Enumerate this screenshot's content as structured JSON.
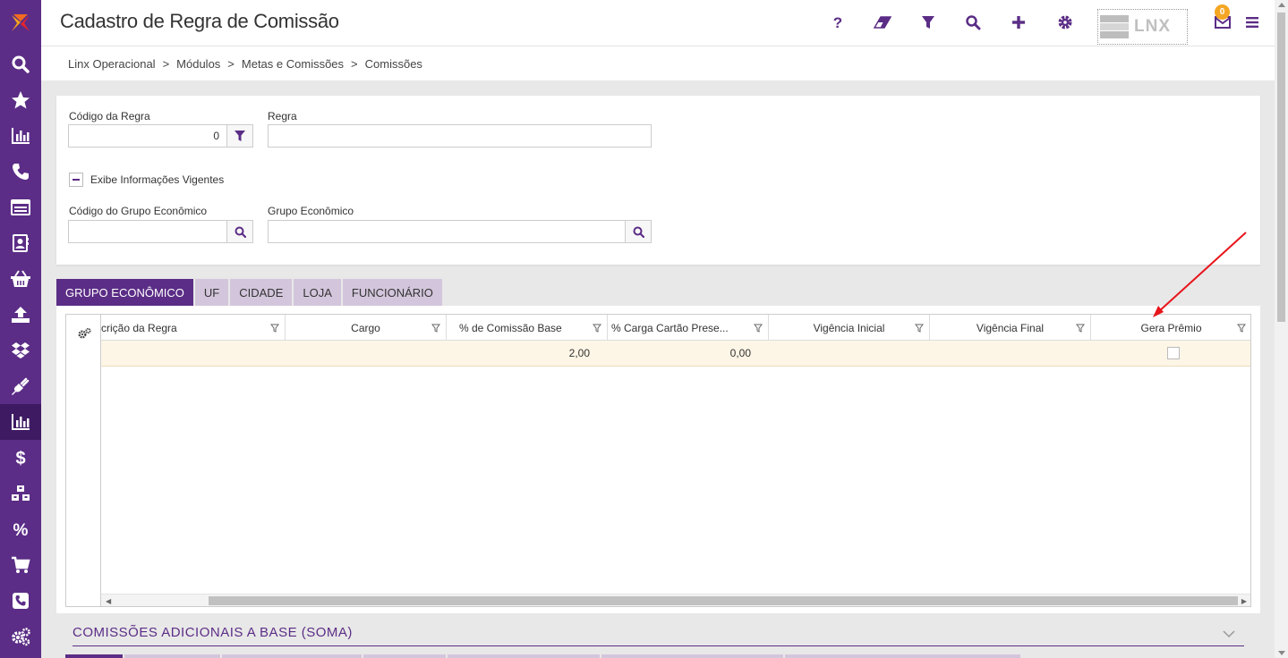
{
  "header": {
    "title": "Cadastro de Regra de Comissão",
    "brand_text": "LNX",
    "notification_count": "0"
  },
  "breadcrumb": [
    "Linx Operacional",
    "Módulos",
    "Metas e Comissões",
    "Comissões"
  ],
  "breadcrumb_separator": ">",
  "filters": {
    "codigo_regra_label": "Código da Regra",
    "codigo_regra_value": "0",
    "regra_label": "Regra",
    "regra_value": "",
    "exibe_label": "Exibe Informações Vigentes",
    "cod_grupo_label": "Código do Grupo Econômico",
    "cod_grupo_value": "",
    "grupo_label": "Grupo Econômico",
    "grupo_value": ""
  },
  "tabs": [
    {
      "label": "GRUPO ECONÔMICO",
      "active": true
    },
    {
      "label": "UF",
      "active": false
    },
    {
      "label": "CIDADE",
      "active": false
    },
    {
      "label": "LOJA",
      "active": false
    },
    {
      "label": "FUNCIONÁRIO",
      "active": false
    }
  ],
  "grid": {
    "columns": [
      "crição da Regra",
      "Cargo",
      "% de Comissão Base",
      "% Carga Cartão Prese...",
      "Vigência Inicial",
      "Vigência Final",
      "Gera Prêmio"
    ],
    "rows": [
      {
        "descricao": "",
        "cargo": "",
        "comissao_base": "2,00",
        "carga_cartao": "0,00",
        "vigencia_inicial": "",
        "vigencia_final": "",
        "gera_premio": false
      }
    ]
  },
  "section": {
    "title": "COMISSÕES ADICIONAIS A BASE (SOMA)"
  },
  "colors": {
    "brand": "#5b2d86",
    "sidebar_active": "#3e1a63",
    "badge": "#f5a623",
    "row_highlight": "#fdf6e6",
    "annotation": "#e8141b"
  },
  "sidebar_icons": [
    "search-icon",
    "star-icon",
    "chart-icon",
    "phone-icon",
    "list-icon",
    "contacts-icon",
    "basket-icon",
    "upload-icon",
    "dropbox-icon",
    "plug-icon",
    "chart-icon",
    "dollar-icon",
    "cubes-icon",
    "percent-icon",
    "cart-icon",
    "phone-square-icon",
    "cogs-icon"
  ]
}
